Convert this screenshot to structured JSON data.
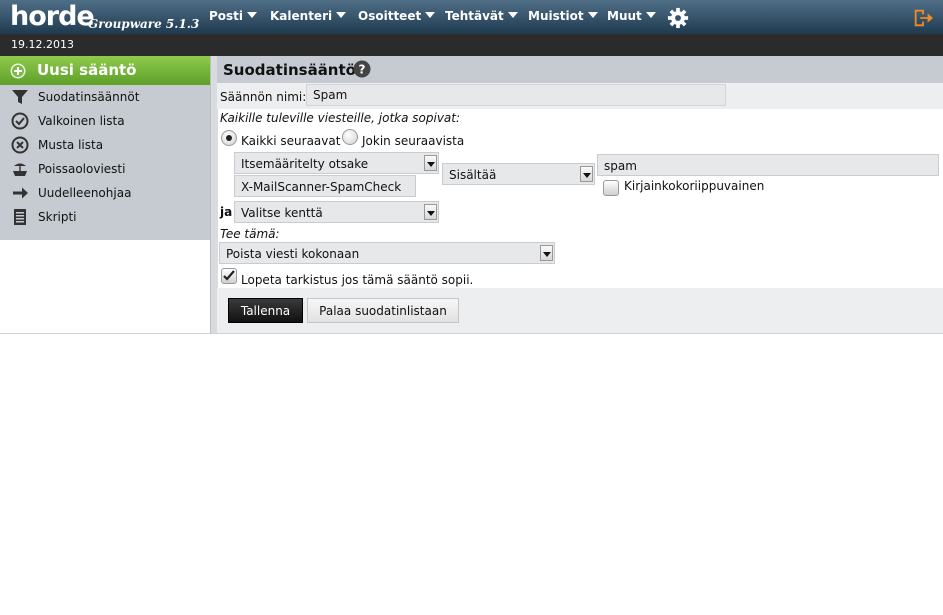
{
  "header": {
    "logo": "horde",
    "app_name": "Groupware 5.1.3",
    "menu": [
      {
        "label": "Posti"
      },
      {
        "label": "Kalenteri"
      },
      {
        "label": "Osoitteet"
      },
      {
        "label": "Tehtävät"
      },
      {
        "label": "Muistiot"
      },
      {
        "label": "Muut"
      }
    ],
    "icons": {
      "settings": "gear-icon",
      "logout": "logout-icon"
    }
  },
  "date": "19.12.2013",
  "sidebar": {
    "new_rule": "Uusi sääntö",
    "items": [
      {
        "label": "Suodatinsäännöt",
        "icon": "funnel-icon"
      },
      {
        "label": "Valkoinen lista",
        "icon": "check-circle-icon"
      },
      {
        "label": "Musta lista",
        "icon": "x-circle-icon"
      },
      {
        "label": "Poissaoloviesti",
        "icon": "vacation-icon"
      },
      {
        "label": "Uudelleenohjaa",
        "icon": "arrow-right-icon"
      },
      {
        "label": "Skripti",
        "icon": "script-icon"
      }
    ]
  },
  "main": {
    "title": "Suodatinsääntö",
    "name_label": "Säännön nimi:",
    "name_value": "Spam",
    "match_intro": "Kaikille tuleville viesteille, jotka sopivat:",
    "match_all": "Kaikki seuraavat",
    "match_any": "Jokin seuraavista",
    "match_selected": "all",
    "condition": {
      "field_select": "Itsemääritelty otsake",
      "custom_header": "X-MailScanner-SpamCheck",
      "operator_select": "Sisältää",
      "value": "spam",
      "case_sensitive_label": "Kirjainkokoriippuvainen",
      "case_sensitive": false
    },
    "and_label": "ja",
    "next_field_select": "Valitse kenttä",
    "action_intro": "Tee tämä:",
    "action_select": "Poista viesti kokonaan",
    "stop_label": "Lopeta tarkistus jos tämä sääntö sopii.",
    "stop_checked": true,
    "save_button": "Tallenna",
    "back_button": "Palaa suodatinlistaan"
  },
  "colors": {
    "topbar": "#2f4d63",
    "datebar": "#2b2b2b",
    "new_rule_green": "#6fb338",
    "sidebar_bg": "#c5cbd0",
    "logout_orange": "#f08a24"
  }
}
